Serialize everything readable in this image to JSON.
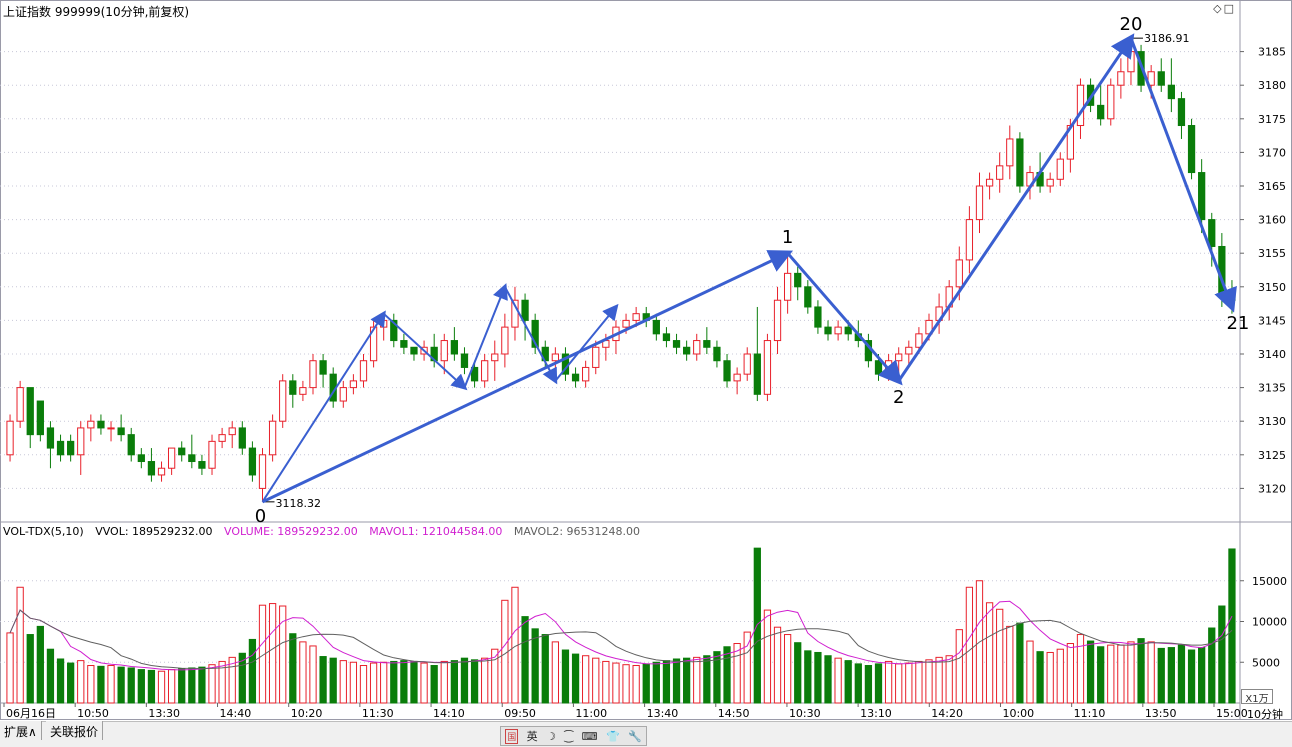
{
  "title": "上证指数 999999(10分钟,前复权)",
  "window_controls": "◇□",
  "price_axis": {
    "ticks": [
      3120,
      3125,
      3130,
      3135,
      3140,
      3145,
      3150,
      3155,
      3160,
      3165,
      3170,
      3175,
      3180,
      3185
    ]
  },
  "volume_axis": {
    "ticks": [
      5000,
      10000,
      15000
    ],
    "unit_label": "X1万"
  },
  "annotations": {
    "low_value": "3118.32",
    "high_value": "3186.91"
  },
  "wave_labels": [
    "0",
    "1",
    "2",
    "20",
    "21"
  ],
  "volume_indicator": {
    "name": "VOL-TDX(5,10)",
    "vvol": "VVOL: 189529232.00",
    "volume": "VOLUME: 189529232.00",
    "mavol1": "MAVOL1: 121044584.00",
    "mavol2": "MAVOL2: 96531248.00"
  },
  "time_axis": [
    "06月16日",
    "10:50",
    "13:30",
    "14:40",
    "10:20",
    "11:30",
    "14:10",
    "09:50",
    "11:00",
    "13:40",
    "14:50",
    "10:30",
    "13:10",
    "14:20",
    "10:00",
    "11:10",
    "13:50",
    "15:00"
  ],
  "period_label": "10分钟",
  "tabs": [
    "扩展∧",
    "关联报价"
  ],
  "ime_bar": [
    "国",
    "英",
    "☽",
    "⁐",
    "⌨",
    "👕",
    "🔧"
  ],
  "colors": {
    "up": "#e8202a",
    "down": "#0a7d0a",
    "arrow": "#3a5fd0",
    "grid": "#c8c8d8",
    "mavol1": "#d020d0",
    "mavol2": "#606060"
  },
  "chart_data": {
    "type": "candlestick",
    "ylim": [
      3115,
      3190
    ],
    "volume_ylim": [
      0,
      20000
    ],
    "candles": [
      [
        3125,
        3131,
        3124,
        3130,
        8600
      ],
      [
        3130,
        3136,
        3129,
        3135,
        14200
      ],
      [
        3135,
        3134,
        3126,
        3128,
        8400
      ],
      [
        3133,
        3133,
        3127,
        3128,
        9400
      ],
      [
        3129,
        3130,
        3123,
        3126,
        6600
      ],
      [
        3127,
        3128,
        3124,
        3125,
        5400
      ],
      [
        3127,
        3128,
        3124,
        3125,
        4900
      ],
      [
        3125,
        3130,
        3122,
        3129,
        5200
      ],
      [
        3129,
        3131,
        3127,
        3130,
        4600
      ],
      [
        3130,
        3131,
        3128,
        3129,
        4500
      ],
      [
        3129,
        3130,
        3127,
        3129,
        4600
      ],
      [
        3129,
        3131,
        3127,
        3128,
        4400
      ],
      [
        3128,
        3129,
        3124,
        3125,
        4300
      ],
      [
        3125,
        3126,
        3123,
        3124,
        4100
      ],
      [
        3124,
        3126,
        3121,
        3122,
        4000
      ],
      [
        3122,
        3124,
        3121,
        3123,
        3900
      ],
      [
        3123,
        3126,
        3122,
        3126,
        4100
      ],
      [
        3126,
        3127,
        3124,
        3125,
        4200
      ],
      [
        3125,
        3128,
        3123,
        3124,
        4300
      ],
      [
        3124,
        3125,
        3122,
        3123,
        4400
      ],
      [
        3123,
        3128,
        3122,
        3127,
        4700
      ],
      [
        3127,
        3129,
        3126,
        3128,
        5100
      ],
      [
        3128,
        3130,
        3126,
        3129,
        5600
      ],
      [
        3129,
        3130,
        3125,
        3126,
        6100
      ],
      [
        3126,
        3127,
        3121,
        3122,
        7800
      ],
      [
        3120,
        3126,
        3118,
        3125,
        12000
      ],
      [
        3125,
        3131,
        3124,
        3130,
        12200
      ],
      [
        3130,
        3137,
        3129,
        3136,
        11900
      ],
      [
        3136,
        3137,
        3132,
        3134,
        8500
      ],
      [
        3134,
        3136,
        3133,
        3135,
        7500
      ],
      [
        3135,
        3140,
        3134,
        3139,
        7000
      ],
      [
        3139,
        3140,
        3135,
        3137,
        5700
      ],
      [
        3137,
        3138,
        3132,
        3133,
        5500
      ],
      [
        3133,
        3136,
        3132,
        3135,
        5200
      ],
      [
        3135,
        3137,
        3134,
        3136,
        5000
      ],
      [
        3136,
        3140,
        3135,
        3139,
        4600
      ],
      [
        3139,
        3145,
        3138,
        3144,
        4900
      ],
      [
        3144,
        3146,
        3142,
        3145,
        5000
      ],
      [
        3145,
        3146,
        3141,
        3142,
        5100
      ],
      [
        3142,
        3143,
        3140,
        3141,
        5200
      ],
      [
        3141,
        3141,
        3139,
        3140,
        5100
      ],
      [
        3140,
        3142,
        3139,
        3141,
        4900
      ],
      [
        3141,
        3143,
        3138,
        3139,
        4600
      ],
      [
        3139,
        3143,
        3137,
        3142,
        5100
      ],
      [
        3142,
        3144,
        3139,
        3140,
        5200
      ],
      [
        3140,
        3141,
        3137,
        3138,
        5500
      ],
      [
        3138,
        3139,
        3135,
        3136,
        5300
      ],
      [
        3136,
        3140,
        3135,
        3139,
        5500
      ],
      [
        3139,
        3142,
        3136,
        3140,
        6600
      ],
      [
        3140,
        3146,
        3138,
        3144,
        12600
      ],
      [
        3144,
        3150,
        3142,
        3148,
        14200
      ],
      [
        3148,
        3149,
        3142,
        3145,
        10600
      ],
      [
        3145,
        3146,
        3140,
        3141,
        9100
      ],
      [
        3141,
        3142,
        3138,
        3139,
        8400
      ],
      [
        3139,
        3141,
        3136,
        3140,
        7500
      ],
      [
        3140,
        3141,
        3136,
        3137,
        6500
      ],
      [
        3137,
        3138,
        3135,
        3136,
        6000
      ],
      [
        3136,
        3139,
        3135,
        3138,
        5800
      ],
      [
        3138,
        3142,
        3137,
        3141,
        5500
      ],
      [
        3141,
        3143,
        3139,
        3142,
        5100
      ],
      [
        3142,
        3145,
        3140,
        3144,
        4900
      ],
      [
        3144,
        3146,
        3143,
        3145,
        4700
      ],
      [
        3145,
        3147,
        3144,
        3146,
        4600
      ],
      [
        3146,
        3147,
        3144,
        3145,
        4800
      ],
      [
        3145,
        3146,
        3142,
        3143,
        5000
      ],
      [
        3143,
        3144,
        3141,
        3142,
        5200
      ],
      [
        3142,
        3143,
        3140,
        3141,
        5400
      ],
      [
        3141,
        3142,
        3139,
        3140,
        5500
      ],
      [
        3140,
        3143,
        3139,
        3142,
        5600
      ],
      [
        3142,
        3144,
        3140,
        3141,
        5800
      ],
      [
        3141,
        3142,
        3138,
        3139,
        6300
      ],
      [
        3139,
        3140,
        3135,
        3136,
        6900
      ],
      [
        3136,
        3138,
        3134,
        3137,
        7300
      ],
      [
        3137,
        3141,
        3136,
        3140,
        8700
      ],
      [
        3140,
        3147,
        3133,
        3134,
        19000
      ],
      [
        3134,
        3143,
        3133,
        3142,
        11400
      ],
      [
        3142,
        3150,
        3140,
        3148,
        9300
      ],
      [
        3148,
        3155,
        3146,
        3152,
        8400
      ],
      [
        3152,
        3153,
        3148,
        3150,
        7400
      ],
      [
        3150,
        3151,
        3146,
        3147,
        6400
      ],
      [
        3147,
        3148,
        3143,
        3144,
        6200
      ],
      [
        3144,
        3145,
        3142,
        3143,
        5800
      ],
      [
        3143,
        3145,
        3142,
        3144,
        5500
      ],
      [
        3144,
        3145,
        3142,
        3143,
        5200
      ],
      [
        3143,
        3145,
        3141,
        3142,
        4800
      ],
      [
        3142,
        3143,
        3138,
        3139,
        4600
      ],
      [
        3139,
        3140,
        3136,
        3137,
        4800
      ],
      [
        3137,
        3140,
        3136,
        3139,
        5100
      ],
      [
        3139,
        3141,
        3137,
        3140,
        4800
      ],
      [
        3140,
        3142,
        3138,
        3141,
        4900
      ],
      [
        3141,
        3144,
        3140,
        3143,
        5100
      ],
      [
        3143,
        3146,
        3142,
        3145,
        5300
      ],
      [
        3145,
        3149,
        3143,
        3147,
        5600
      ],
      [
        3147,
        3151,
        3145,
        3150,
        5800
      ],
      [
        3150,
        3156,
        3148,
        3154,
        9000
      ],
      [
        3154,
        3162,
        3152,
        3160,
        14200
      ],
      [
        3160,
        3167,
        3158,
        3165,
        15000
      ],
      [
        3165,
        3167,
        3163,
        3166,
        12300
      ],
      [
        3166,
        3170,
        3164,
        3168,
        11500
      ],
      [
        3168,
        3174,
        3166,
        3172,
        9400
      ],
      [
        3172,
        3173,
        3164,
        3165,
        9800
      ],
      [
        3165,
        3168,
        3163,
        3167,
        7600
      ],
      [
        3167,
        3170,
        3164,
        3165,
        6300
      ],
      [
        3165,
        3167,
        3164,
        3166,
        6200
      ],
      [
        3166,
        3170,
        3165,
        3169,
        6600
      ],
      [
        3169,
        3175,
        3167,
        3174,
        7300
      ],
      [
        3174,
        3181,
        3172,
        3180,
        8400
      ],
      [
        3180,
        3181,
        3176,
        3177,
        7600
      ],
      [
        3177,
        3180,
        3174,
        3175,
        6900
      ],
      [
        3175,
        3181,
        3174,
        3180,
        7100
      ],
      [
        3180,
        3184,
        3178,
        3182,
        7100
      ],
      [
        3182,
        3187,
        3180,
        3185,
        7500
      ],
      [
        3185,
        3186,
        3179,
        3180,
        7900
      ],
      [
        3180,
        3183,
        3178,
        3182,
        7500
      ],
      [
        3182,
        3184,
        3179,
        3180,
        6700
      ],
      [
        3180,
        3184,
        3176,
        3178,
        6800
      ],
      [
        3178,
        3179,
        3172,
        3174,
        7100
      ],
      [
        3174,
        3175,
        3166,
        3167,
        6500
      ],
      [
        3167,
        3169,
        3158,
        3160,
        6800
      ],
      [
        3160,
        3161,
        3153,
        3156,
        9200
      ],
      [
        3156,
        3158,
        3147,
        3149,
        11900
      ],
      [
        3149,
        3151,
        3146,
        3148,
        18900
      ]
    ]
  }
}
